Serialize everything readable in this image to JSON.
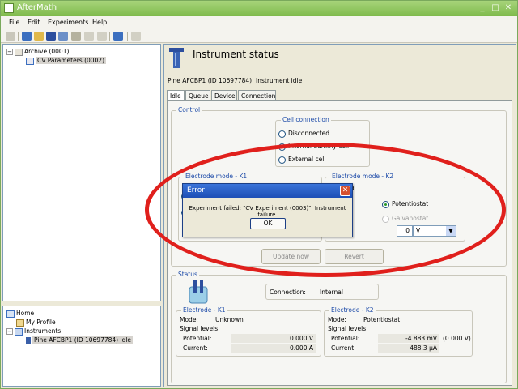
{
  "app": {
    "title": "AfterMath"
  },
  "menu": {
    "file": "File",
    "edit": "Edit",
    "experiments": "Experiments",
    "help": "Help"
  },
  "archive_tree": {
    "root": "Archive (0001)",
    "child": "CV Parameters (0002)"
  },
  "nav_tree": {
    "home": "Home",
    "profile": "My Profile",
    "instruments": "Instruments",
    "instrument": "Pine AFCBP1 (ID 10697784) idle"
  },
  "main": {
    "heading": "Instrument status",
    "instrument_line": "Pine AFCBP1 (ID 10697784): Instrument idle",
    "tabs": [
      "Idle",
      "Queue",
      "Device",
      "Connection"
    ]
  },
  "control": {
    "label": "Control",
    "cell_connection": {
      "label": "Cell connection",
      "options": [
        "Disconnected",
        "Internal dummy cell",
        "External cell"
      ],
      "selected": "Internal dummy cell"
    },
    "k1_label": "Electrode mode - K1",
    "k2_label": "Electrode mode - K2",
    "k2_partial": "nnected",
    "potentiostat": "Potentiostat",
    "galvanostat": "Galvanostat",
    "k2_value": "0",
    "k2_unit": "V",
    "update_button": "Update now",
    "revert_button": "Revert"
  },
  "status": {
    "label": "Status",
    "connection_label": "Connection:",
    "connection_value": "Internal",
    "k1": {
      "label": "Electrode - K1",
      "mode_label": "Mode:",
      "mode_value": "Unknown",
      "signal_label": "Signal levels:",
      "potential_label": "Potential:",
      "potential_value": "0.000 V",
      "current_label": "Current:",
      "current_value": "0.000 A"
    },
    "k2": {
      "label": "Electrode - K2",
      "mode_label": "Mode:",
      "mode_value": "Potentiostat",
      "signal_label": "Signal levels:",
      "potential_label": "Potential:",
      "potential_value": "-4.883 mV",
      "potential_extra": "(0.000 V)",
      "current_label": "Current:",
      "current_value": "488.3 µA"
    }
  },
  "dialog": {
    "title": "Error",
    "message": "Experiment failed: \"CV Experiment (0003)\". Instrument failure.",
    "ok": "OK"
  },
  "colors": {
    "accent_ring": "#e0201c",
    "titlebar": "#8cc63f",
    "group_label": "#1c4aa8"
  }
}
